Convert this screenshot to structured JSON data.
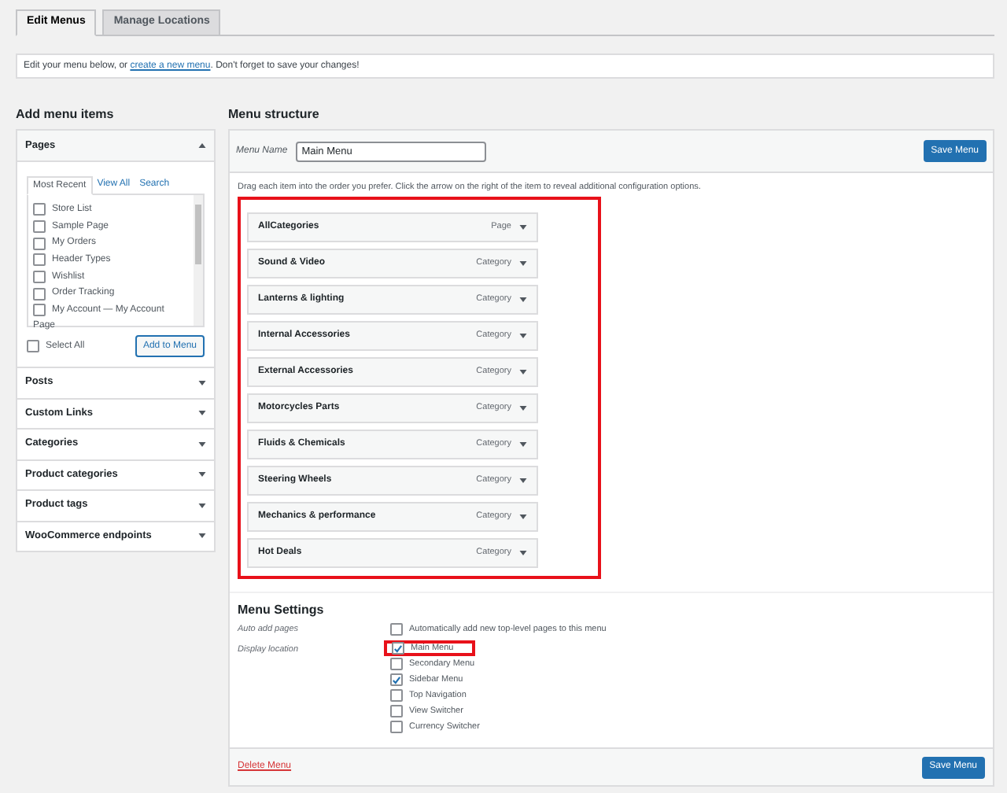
{
  "tabs": [
    {
      "label": "Edit Menus",
      "selected": true
    },
    {
      "label": "Manage Locations",
      "selected": false
    }
  ],
  "notice": {
    "before": "Edit your menu below, or ",
    "link": "create a new menu",
    "after": ". Don't forget to save your changes!"
  },
  "add_items": {
    "heading": "Add menu items",
    "pages": {
      "title": "Pages",
      "expanded": true,
      "tabs": [
        {
          "label": "Most Recent",
          "selected": true
        },
        {
          "label": "View All",
          "selected": false
        },
        {
          "label": "Search",
          "selected": false
        }
      ],
      "items": [
        {
          "label": "Store List",
          "checked": false
        },
        {
          "label": "Sample Page",
          "checked": false
        },
        {
          "label": "My Orders",
          "checked": false
        },
        {
          "label": "Header Types",
          "checked": false
        },
        {
          "label": "Wishlist",
          "checked": false
        },
        {
          "label": "Order Tracking",
          "checked": false
        },
        {
          "label": "My Account — My Account",
          "checked": false
        }
      ],
      "group_label": "Page",
      "select_all": {
        "label": "Select All",
        "checked": false
      },
      "add_button": "Add to Menu"
    },
    "sections": [
      {
        "title": "Posts",
        "expanded": false
      },
      {
        "title": "Custom Links",
        "expanded": false
      },
      {
        "title": "Categories",
        "expanded": false
      },
      {
        "title": "Product categories",
        "expanded": false
      },
      {
        "title": "Product tags",
        "expanded": false
      },
      {
        "title": "WooCommerce endpoints",
        "expanded": false
      }
    ]
  },
  "structure": {
    "heading": "Menu structure",
    "name_label": "Menu Name",
    "name_value": "Main Menu",
    "save_button": "Save Menu",
    "instructions": "Drag each item into the order you prefer. Click the arrow on the right of the item to reveal additional configuration options.",
    "items": [
      {
        "title": "AllCategories",
        "type": "Page"
      },
      {
        "title": "Sound & Video",
        "type": "Category"
      },
      {
        "title": "Lanterns & lighting",
        "type": "Category"
      },
      {
        "title": "Internal Accessories",
        "type": "Category"
      },
      {
        "title": "External Accessories",
        "type": "Category"
      },
      {
        "title": "Motorcycles Parts",
        "type": "Category"
      },
      {
        "title": "Fluids & Chemicals",
        "type": "Category"
      },
      {
        "title": "Steering Wheels",
        "type": "Category"
      },
      {
        "title": "Mechanics & performance",
        "type": "Category"
      },
      {
        "title": "Hot Deals",
        "type": "Category"
      }
    ]
  },
  "settings": {
    "heading": "Menu Settings",
    "auto_add_label": "Auto add pages",
    "auto_add": {
      "label": "Automatically add new top-level pages to this menu",
      "checked": false
    },
    "display_label": "Display location",
    "locations": [
      {
        "label": "Main Menu",
        "checked": true,
        "highlighted": true
      },
      {
        "label": "Secondary Menu",
        "checked": false,
        "highlighted": false
      },
      {
        "label": "Sidebar Menu",
        "checked": true,
        "highlighted": false
      },
      {
        "label": "Top Navigation",
        "checked": false,
        "highlighted": false
      },
      {
        "label": "View Switcher",
        "checked": false,
        "highlighted": false
      },
      {
        "label": "Currency Switcher",
        "checked": false,
        "highlighted": false
      }
    ]
  },
  "footer": {
    "delete_link": "Delete Menu",
    "save_button": "Save Menu"
  }
}
